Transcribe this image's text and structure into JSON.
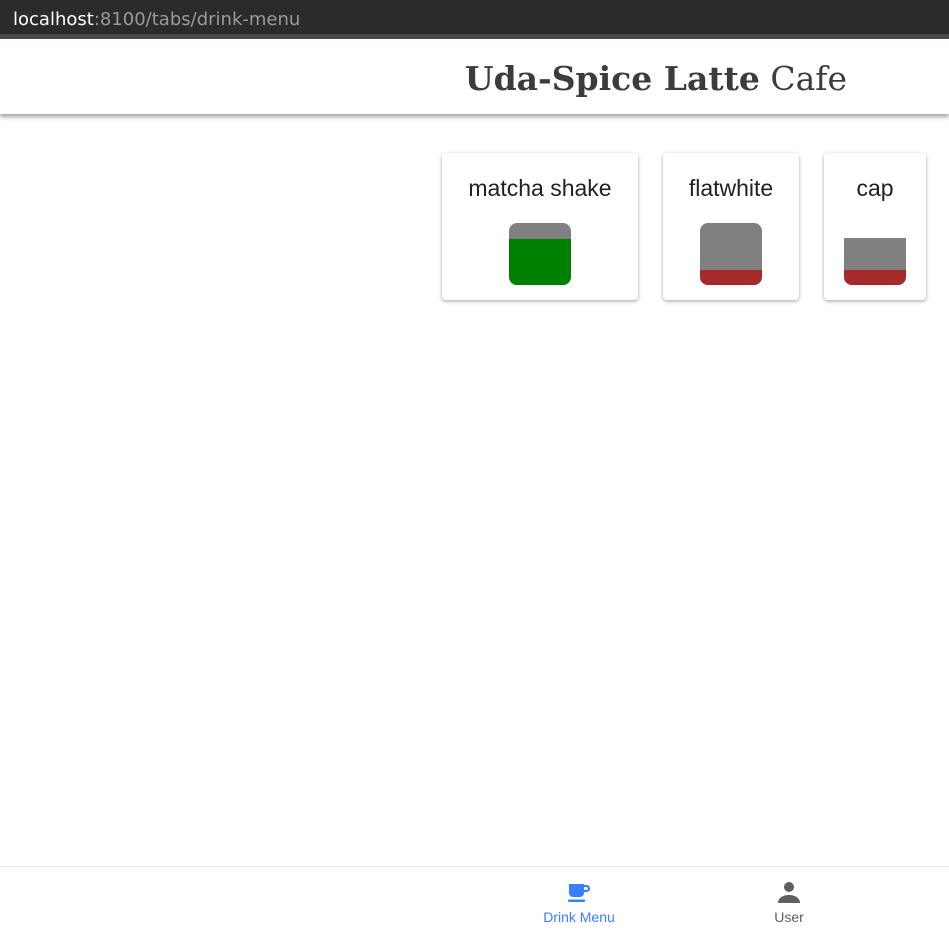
{
  "browser": {
    "url_host": "localhost",
    "url_rest": ":8100/tabs/drink-menu"
  },
  "header": {
    "title_bold": "Uda-Spice Latte",
    "title_light": "Cafe"
  },
  "drinks": [
    {
      "name": "matcha shake",
      "cup_style": "rounded",
      "fill_color": "#008000",
      "fill_level": 0.75
    },
    {
      "name": "flatwhite",
      "cup_style": "rounded",
      "fill_color": "#a52a2a",
      "fill_level": 0.25
    },
    {
      "name": "cap",
      "cup_style": "flat",
      "fill_color": "#a52a2a",
      "fill_level": 0.33
    }
  ],
  "tabs": [
    {
      "label": "Drink Menu",
      "icon": "cafe-icon",
      "selected": true
    },
    {
      "label": "User",
      "icon": "person-icon",
      "selected": false
    }
  ],
  "colors": {
    "tab_active": "#3880ff",
    "tab_inactive": "#5f5f5f",
    "cup_empty": "#808080"
  }
}
